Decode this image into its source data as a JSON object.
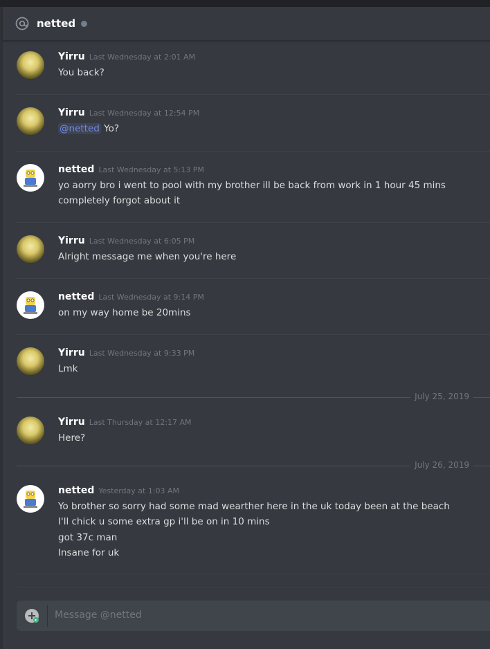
{
  "channel": {
    "at_icon": "at-icon",
    "title": "netted",
    "status": "offline"
  },
  "messages": [
    {
      "author": "Yirru",
      "timestamp": "Last Wednesday at 2:01 AM",
      "lines": [
        "You back?"
      ]
    },
    {
      "author": "Yirru",
      "timestamp": "Last Wednesday at 12:54 PM",
      "mention": "@netted",
      "lines": [
        "Yo?"
      ]
    },
    {
      "author": "netted",
      "timestamp": "Last Wednesday at 5:13 PM",
      "lines": [
        "yo aorry bro i went to pool with my brother ill be back from work in 1 hour 45 mins",
        "completely forgot about it"
      ]
    },
    {
      "author": "Yirru",
      "timestamp": "Last Wednesday at 6:05 PM",
      "lines": [
        "Alright message me when you're here"
      ]
    },
    {
      "author": "netted",
      "timestamp": "Last Wednesday at 9:14 PM",
      "lines": [
        "on my way home be 20mins"
      ]
    },
    {
      "author": "Yirru",
      "timestamp": "Last Wednesday at 9:33 PM",
      "lines": [
        "Lmk"
      ]
    },
    {
      "author": "Yirru",
      "timestamp": "Last Thursday at 12:17 AM",
      "lines": [
        "Here?"
      ]
    },
    {
      "author": "netted",
      "timestamp": "Yesterday at 1:03 AM",
      "lines": [
        "Yo brother so sorry had some mad wearther here in the uk today been at the beach",
        "I'll chick u some extra gp i'll be on in 10 mins",
        "got 37c man",
        "Insane for uk"
      ]
    }
  ],
  "date_separators": [
    "July 25, 2019",
    "July 26, 2019"
  ],
  "composer": {
    "placeholder": "Message @netted",
    "upload_icon": "add-file-icon"
  }
}
